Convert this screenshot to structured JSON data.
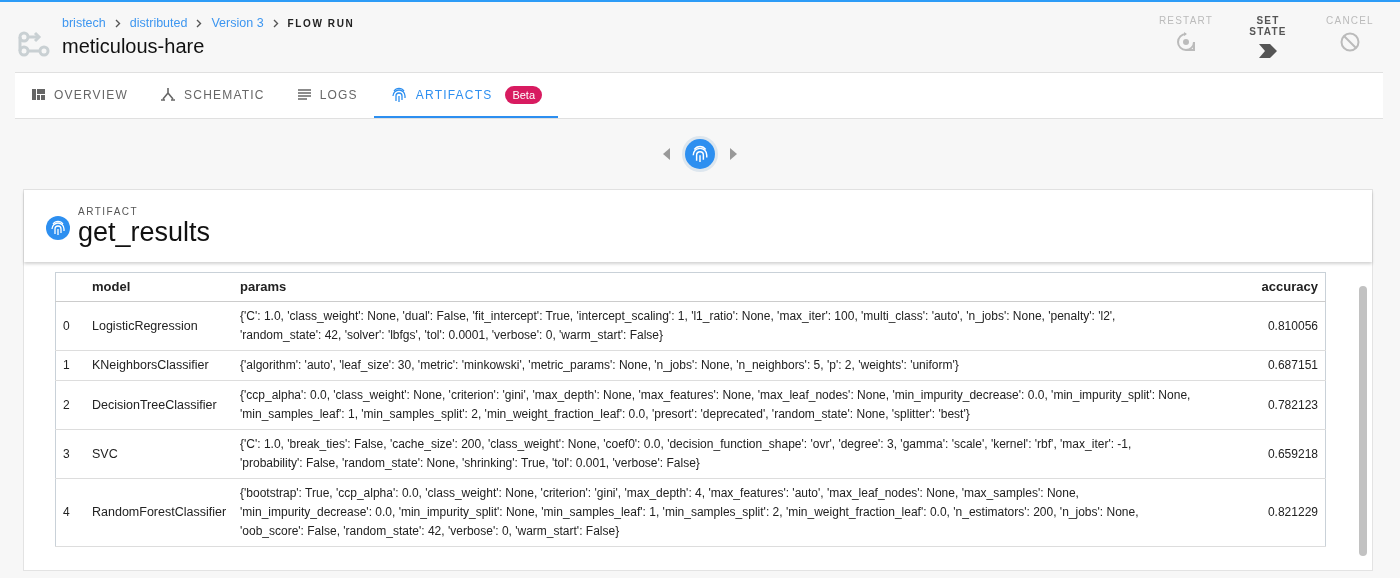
{
  "breadcrumbs": [
    {
      "label": "bristech",
      "kind": "link"
    },
    {
      "label": "distributed",
      "kind": "link"
    },
    {
      "label": "Version 3",
      "kind": "link"
    },
    {
      "label": "FLOW RUN",
      "kind": "current"
    }
  ],
  "title": "meticulous-hare",
  "actions": [
    {
      "label": "RESTART",
      "kind": "restart",
      "disabled": true
    },
    {
      "label": "SET STATE",
      "kind": "set-state",
      "disabled": false
    },
    {
      "label": "CANCEL",
      "kind": "cancel",
      "disabled": true
    }
  ],
  "tabs": [
    {
      "label": "OVERVIEW",
      "kind": "overview",
      "selected": false
    },
    {
      "label": "SCHEMATIC",
      "kind": "schematic",
      "selected": false
    },
    {
      "label": "LOGS",
      "kind": "logs",
      "selected": false
    },
    {
      "label": "ARTIFACTS",
      "kind": "artifacts",
      "selected": true,
      "badge": "Beta"
    }
  ],
  "artifact": {
    "label": "ARTIFACT",
    "name": "get_results"
  },
  "table": {
    "columns": [
      "model",
      "params",
      "accuracy"
    ],
    "rows": [
      {
        "index": "0",
        "model": "LogisticRegression",
        "params": "{'C': 1.0, 'class_weight': None, 'dual': False, 'fit_intercept': True, 'intercept_scaling': 1, 'l1_ratio': None, 'max_iter': 100, 'multi_class': 'auto', 'n_jobs': None, 'penalty': 'l2', 'random_state': 42, 'solver': 'lbfgs', 'tol': 0.0001, 'verbose': 0, 'warm_start': False}",
        "accuracy": "0.810056"
      },
      {
        "index": "1",
        "model": "KNeighborsClassifier",
        "params": "{'algorithm': 'auto', 'leaf_size': 30, 'metric': 'minkowski', 'metric_params': None, 'n_jobs': None, 'n_neighbors': 5, 'p': 2, 'weights': 'uniform'}",
        "accuracy": "0.687151"
      },
      {
        "index": "2",
        "model": "DecisionTreeClassifier",
        "params": "{'ccp_alpha': 0.0, 'class_weight': None, 'criterion': 'gini', 'max_depth': None, 'max_features': None, 'max_leaf_nodes': None, 'min_impurity_decrease': 0.0, 'min_impurity_split': None, 'min_samples_leaf': 1, 'min_samples_split': 2, 'min_weight_fraction_leaf': 0.0, 'presort': 'deprecated', 'random_state': None, 'splitter': 'best'}",
        "accuracy": "0.782123"
      },
      {
        "index": "3",
        "model": "SVC",
        "params": "{'C': 1.0, 'break_ties': False, 'cache_size': 200, 'class_weight': None, 'coef0': 0.0, 'decision_function_shape': 'ovr', 'degree': 3, 'gamma': 'scale', 'kernel': 'rbf', 'max_iter': -1, 'probability': False, 'random_state': None, 'shrinking': True, 'tol': 0.001, 'verbose': False}",
        "accuracy": "0.659218"
      },
      {
        "index": "4",
        "model": "RandomForestClassifier",
        "params": "{'bootstrap': True, 'ccp_alpha': 0.0, 'class_weight': None, 'criterion': 'gini', 'max_depth': 4, 'max_features': 'auto', 'max_leaf_nodes': None, 'max_samples': None, 'min_impurity_decrease': 0.0, 'min_impurity_split': None, 'min_samples_leaf': 1, 'min_samples_split': 2, 'min_weight_fraction_leaf': 0.0, 'n_estimators': 200, 'n_jobs': None, 'oob_score': False, 'random_state': 42, 'verbose': 0, 'warm_start': False}",
        "accuracy": "0.821229"
      }
    ]
  }
}
